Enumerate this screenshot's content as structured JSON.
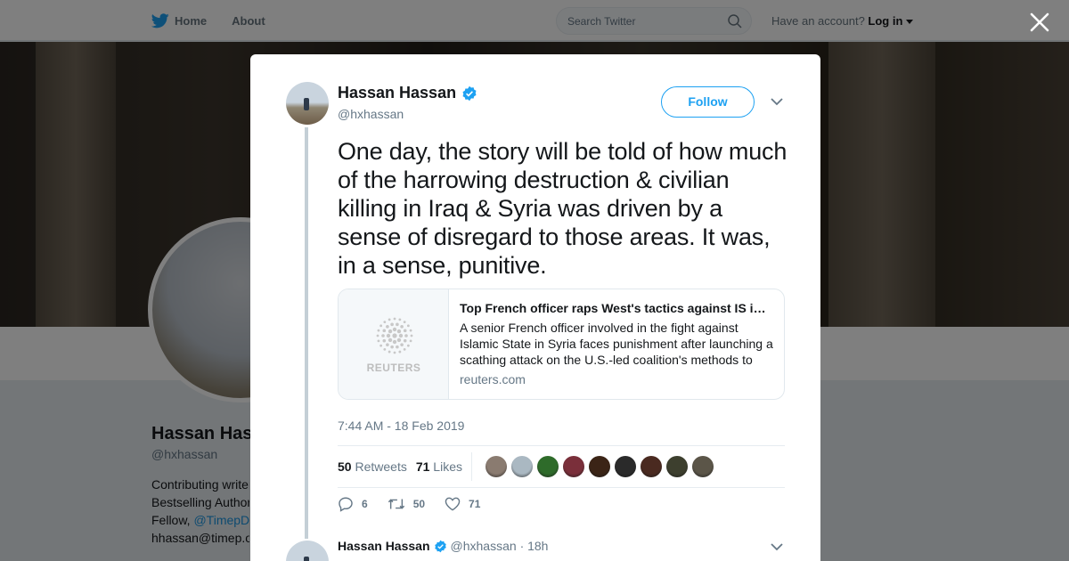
{
  "topbar": {
    "nav": [
      {
        "label": "Home",
        "icon": "twitter-bird-icon"
      },
      {
        "label": "About"
      }
    ],
    "search_placeholder": "Search Twitter",
    "account_prompt": "Have an account?",
    "login_label": "Log in"
  },
  "background_profile": {
    "name": "Hassan Has",
    "handle": "@hxhassan",
    "bio_lines": [
      "Contributing writer",
      "Bestselling Author",
      "Fellow, ",
      "hhassan@timep.o"
    ],
    "bio_link": "@TimepD"
  },
  "modal": {
    "tweet": {
      "display_name": "Hassan Hassan",
      "verified": true,
      "handle": "@hxhassan",
      "follow_label": "Follow",
      "text": "One day, the story will be told of how much of the harrowing destruction & civilian killing in Iraq & Syria was driven by a sense of disregard to those areas. It was, in a sense, punitive.",
      "card": {
        "image_brand": "REUTERS",
        "title": "Top French officer raps West's tactics against IS in Syria",
        "description": "A senior French officer involved in the fight against Islamic State in Syria faces punishment after launching a scathing attack on the U.S.-led coalition's methods to",
        "domain": "reuters.com"
      },
      "timestamp": "7:44 AM - 18 Feb 2019",
      "retweets_count": "50",
      "retweets_label": "Retweets",
      "likes_count": "71",
      "likes_label": "Likes",
      "liker_avatar_colors": [
        "#8a7b70",
        "#aab8c2",
        "#2e6b2a",
        "#7a2f3a",
        "#3b2416",
        "#2a2a2a",
        "#4a2a20",
        "#3d3f2e",
        "#5b5548"
      ],
      "actions": {
        "reply_count": "6",
        "retweet_count": "50",
        "like_count": "71"
      }
    },
    "reply": {
      "display_name": "Hassan Hassan",
      "handle": "@hxhassan",
      "time": "· 18h"
    }
  },
  "colors": {
    "accent": "#1da1f2",
    "verified": "#1da1f2",
    "secondary_text": "#657786"
  }
}
